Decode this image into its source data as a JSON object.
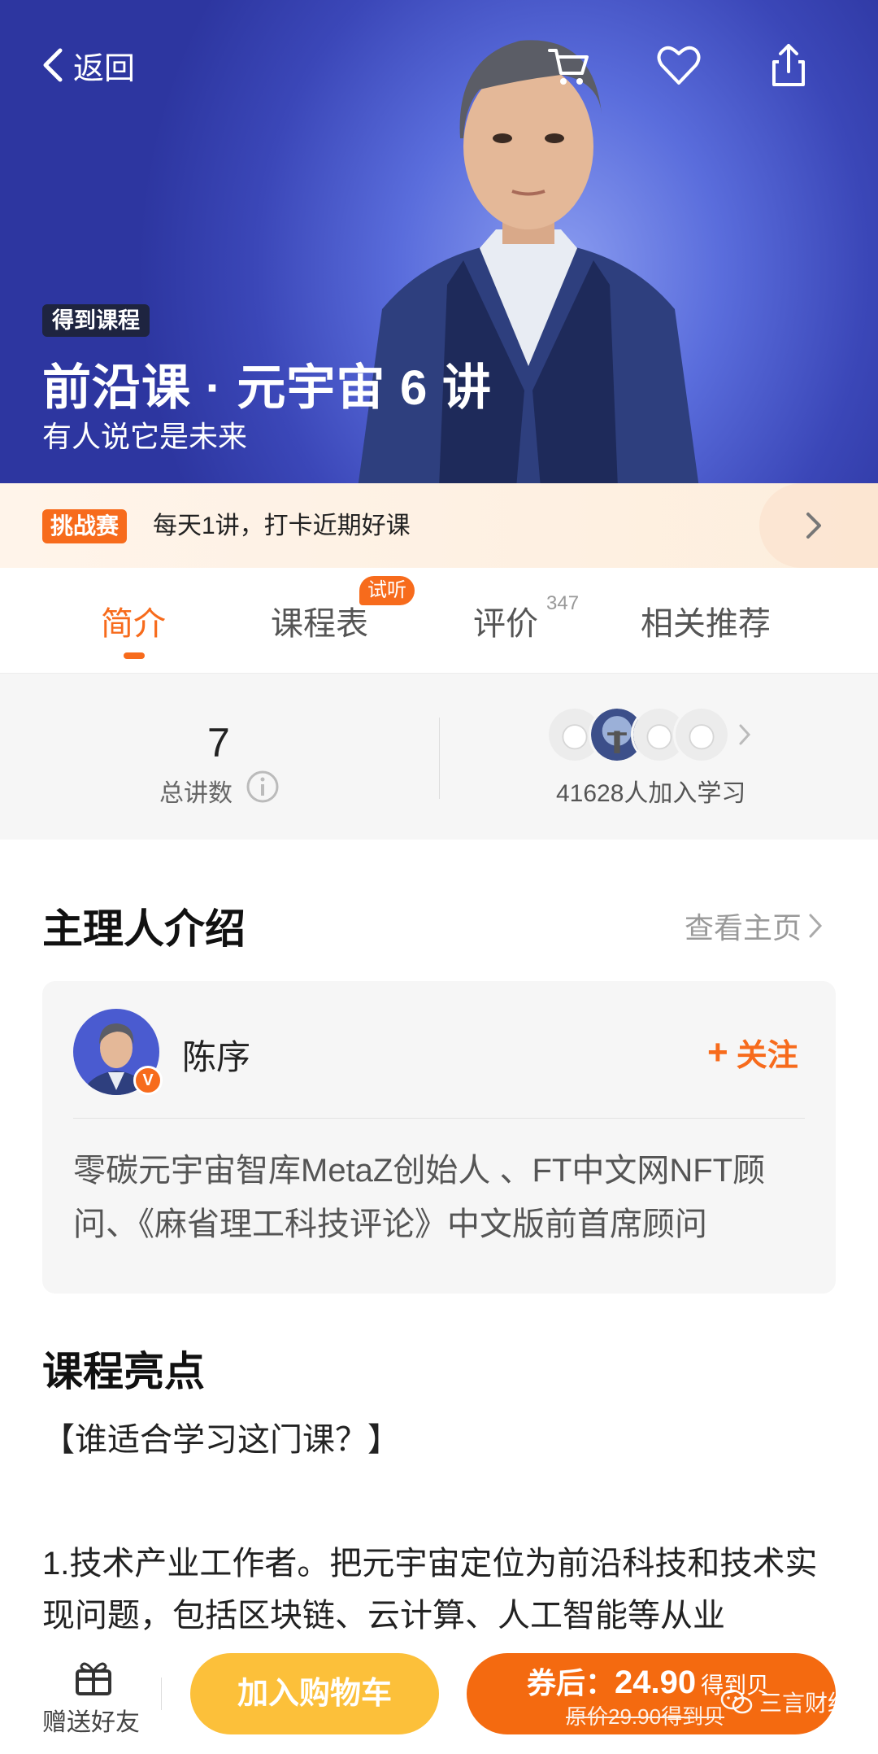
{
  "header": {
    "back_label": "返回",
    "badge": "得到课程",
    "title": "前沿课 · 元宇宙 6 讲",
    "subtitle": "有人说它是未来"
  },
  "icons": {
    "back": "chevron-left-icon",
    "cart": "cart-icon",
    "favorite": "heart-icon",
    "share": "share-icon",
    "info": "info-icon",
    "gift": "gift-icon",
    "wechat": "wechat-icon"
  },
  "challenge": {
    "tag": "挑战赛",
    "text": "每天1讲，打卡近期好课"
  },
  "tabs": [
    {
      "label": "简介",
      "active": true
    },
    {
      "label": "课程表",
      "bubble": "试听"
    },
    {
      "label": "评价",
      "count": "347"
    },
    {
      "label": "相关推荐"
    }
  ],
  "stats": {
    "lectures_value": "7",
    "lectures_label": "总讲数",
    "learners_text": "41628人加入学习"
  },
  "host": {
    "section_title": "主理人介绍",
    "homepage_link": "查看主页",
    "name": "陈序",
    "verified_badge": "V",
    "follow_label": "关注",
    "bio": "零碳元宇宙智库MetaZ创始人 、FT中文网NFT顾问、《麻省理工科技评论》中文版前首席顾问"
  },
  "highlights": {
    "section_title": "课程亮点",
    "question": "【谁适合学习这门课？】",
    "point_1": "1.技术产业工作者。把元宇宙定位为前沿科技和技术实现问题，包括区块链、云计算、人工智能等从业"
  },
  "bottom_bar": {
    "gift_label": "赠送好友",
    "add_to_cart": "加入购物车",
    "coupon_prefix": "券后：",
    "price": "24.90",
    "price_unit": "得到贝",
    "original_price": "原价29.90得到贝",
    "watermark": "三言财经"
  },
  "colors": {
    "accent": "#f76b1c",
    "cart_button": "#fcc03a",
    "buy_button": "#f46a10",
    "hero_bg": "#3b47b8"
  }
}
